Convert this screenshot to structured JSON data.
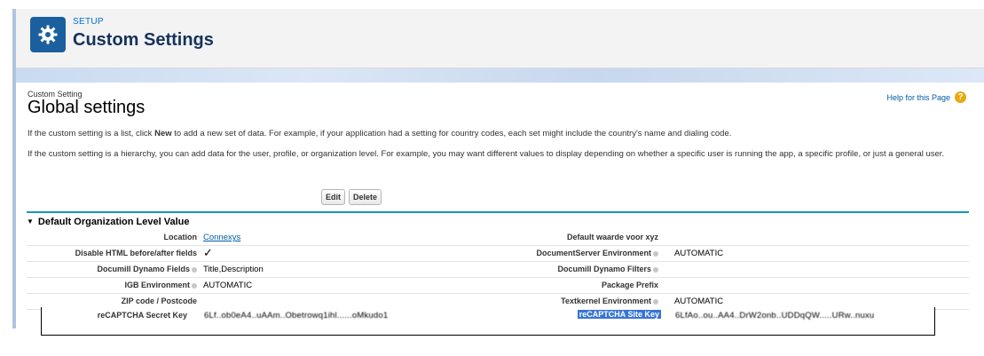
{
  "header": {
    "eyebrow": "SETUP",
    "title": "Custom Settings"
  },
  "page": {
    "crumb": "Custom Setting",
    "title": "Global settings",
    "help_label": "Help for this Page",
    "info_1_pre": "If the custom setting is a list, click ",
    "info_1_bold": "New",
    "info_1_post": " to add a new set of data. For example, if your application had a setting for country codes, each set might include the country's name and dialing code.",
    "info_2": "If the custom setting is a hierarchy, you can add data for the user, profile, or organization level. For example, you may want different values to display depending on whether a specific user is running the app, a specific profile, or just a general user."
  },
  "buttons": {
    "edit": "Edit",
    "delete": "Delete"
  },
  "section": {
    "title": "Default Organization Level Value"
  },
  "fields": {
    "location_label": "Location",
    "location_value": "Connexys",
    "default_label": "Default waarde voor xyz",
    "default_value": "",
    "disable_html_label": "Disable HTML before/after fields",
    "disable_html_value": "✓",
    "docserver_label": "DocumentServer Environment",
    "docserver_value": "AUTOMATIC",
    "dynamo_fields_label": "Documill Dynamo Fields",
    "dynamo_fields_value": "Title,Description",
    "dynamo_filters_label": "Documill Dynamo Filters",
    "dynamo_filters_value": "",
    "igb_label": "IGB Environment",
    "igb_value": "AUTOMATIC",
    "pkg_label": "Package Prefix",
    "pkg_value": "",
    "zip_label": "ZIP code / Postcode",
    "zip_value": "",
    "textkernel_label": "Textkernel Environment",
    "textkernel_value": "AUTOMATIC",
    "recaptcha_secret_label": "reCAPTCHA Secret Key",
    "recaptcha_secret_value": "6Lf..ob0eA4..uAAm..Obetrowq1ihl......oMkudo1",
    "recaptcha_site_label": "reCAPTCHA Site Key",
    "recaptcha_site_value": "6LfAo..ou..AA4..DrW2onb..UDDqQW.....URw..nuxu"
  }
}
